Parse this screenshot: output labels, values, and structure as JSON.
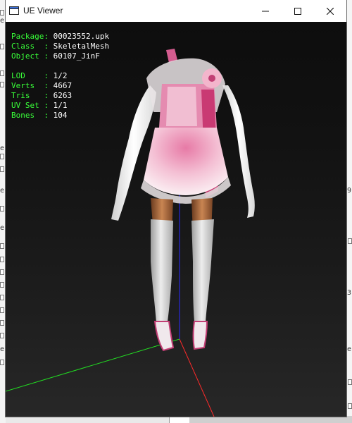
{
  "window": {
    "title": "UE Viewer",
    "icon": "app-icon",
    "controls": {
      "minimize": "minimize-icon",
      "maximize": "maximize-icon",
      "close": "close-icon"
    }
  },
  "info": {
    "package": {
      "label": "Package: ",
      "value": "00023552.upk"
    },
    "class": {
      "label": "Class  : ",
      "value": "SkeletalMesh"
    },
    "object": {
      "label": "Object : ",
      "value": "60107_JinF"
    },
    "lod": {
      "label": "LOD    : ",
      "value": "1/2"
    },
    "verts": {
      "label": "Verts  : ",
      "value": "4667"
    },
    "tris": {
      "label": "Tris   : ",
      "value": "6263"
    },
    "uvset": {
      "label": "UV Set : ",
      "value": "1/1"
    },
    "bones": {
      "label": "Bones  : ",
      "value": "104"
    }
  },
  "colors": {
    "info_label": "#39ff39",
    "info_value": "#ffffff",
    "axis_x": "#ff2a2a",
    "axis_y": "#22dd22",
    "axis_z": "#2a2aff"
  },
  "background": {
    "left_chars": [
      "e",
      "e",
      "e",
      "e",
      "e"
    ],
    "right_chars": [
      "9",
      "3",
      "e"
    ]
  }
}
